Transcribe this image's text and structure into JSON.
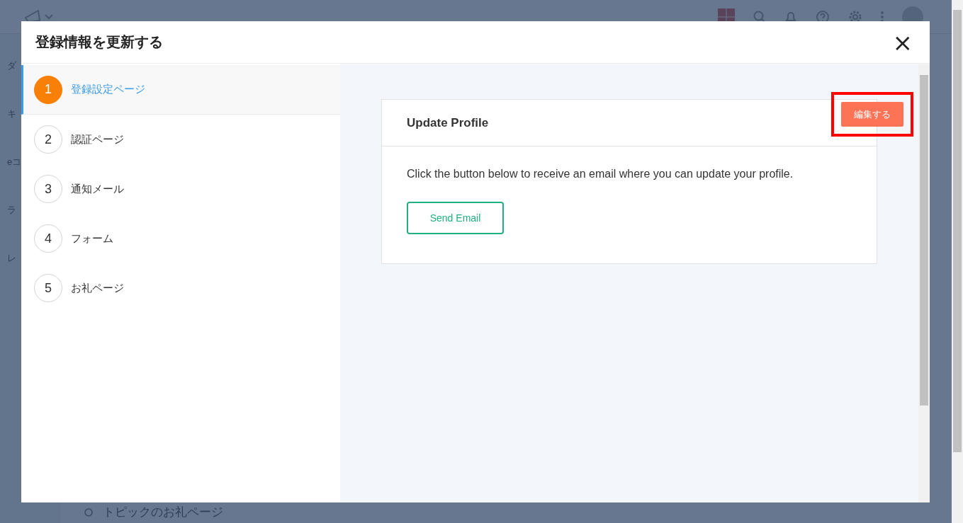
{
  "background": {
    "sidebar_items": [
      "ダ",
      "キ",
      "eコ",
      "ラ",
      "レ"
    ],
    "list_item": "トピックのお礼ページ"
  },
  "dialog": {
    "title": "登録情報を更新する",
    "close": "×",
    "steps": [
      {
        "number": "1",
        "label": "登録設定ページ",
        "selected": true
      },
      {
        "number": "2",
        "label": "認証ページ",
        "selected": false
      },
      {
        "number": "3",
        "label": "通知メール",
        "selected": false
      },
      {
        "number": "4",
        "label": "フォーム",
        "selected": false
      },
      {
        "number": "5",
        "label": "お礼ページ",
        "selected": false
      }
    ],
    "card": {
      "title": "Update Profile",
      "text": "Click the button below to receive an email where you can update your profile.",
      "button": "Send Email"
    },
    "edit_button": "編集する",
    "edit_highlighted": true
  }
}
